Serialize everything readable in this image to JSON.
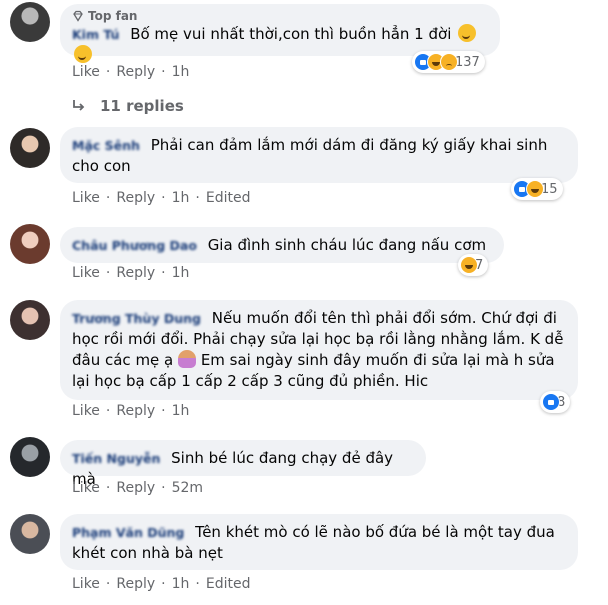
{
  "comments": [
    {
      "badge": "Top fan",
      "author": "Kim Tú",
      "text": "Bố mẹ vui nhất thời,con thì buồn hẳn 1 đời",
      "actions": [
        "Like",
        "Reply",
        "1h"
      ],
      "reactions": {
        "icons": [
          "like-icon",
          "haha-icon",
          "sad-icon"
        ],
        "count": "137"
      },
      "replies": "11 replies"
    },
    {
      "author": "Mặc Sênh",
      "text": "Phải can đảm lắm mới dám đi đăng ký giấy khai sinh cho con",
      "actions": [
        "Like",
        "Reply",
        "1h",
        "Edited"
      ],
      "reactions": {
        "icons": [
          "like-icon",
          "haha-icon"
        ],
        "count": "15"
      }
    },
    {
      "author": "Châu Phương Dao",
      "text": "Gia đình sinh cháu lúc đang nấu cơm",
      "actions": [
        "Like",
        "Reply",
        "1h"
      ],
      "reactions": {
        "icons": [
          "haha-icon"
        ],
        "count": "7"
      }
    },
    {
      "author": "Trương Thùy Dung",
      "text": "Nếu muốn đổi tên thì phải đổi sớm. Chứ đợi đi học rồi mới đổi. Phải chạy sửa lại học bạ rồi lằng nhằng lắm. K dễ đâu các mẹ ạ",
      "text2": "Em sai ngày sinh đây muốn đi sửa lại mà h sửa lại học bạ cấp 1 cấp 2 cấp 3 cũng đủ phiền. Hic",
      "actions": [
        "Like",
        "Reply",
        "1h"
      ],
      "reactions": {
        "icons": [
          "like-icon"
        ],
        "count": "8"
      }
    },
    {
      "author": "Tiến Nguyễn",
      "text": "Sinh bé lúc đang chạy đẻ đây mà",
      "actions": [
        "Like",
        "Reply",
        "52m"
      ]
    },
    {
      "author": "Phạm Văn Dũng",
      "text": "Tên khét mò có lẽ nào bố đứa bé là một tay đua khét con nhà bà nẹt",
      "actions": [
        "Like",
        "Reply",
        "1h",
        "Edited"
      ]
    }
  ],
  "colors": {
    "bubble": "#f0f2f5",
    "meta": "#65676b",
    "like": "#1877f2",
    "haha": "#f7b125"
  }
}
